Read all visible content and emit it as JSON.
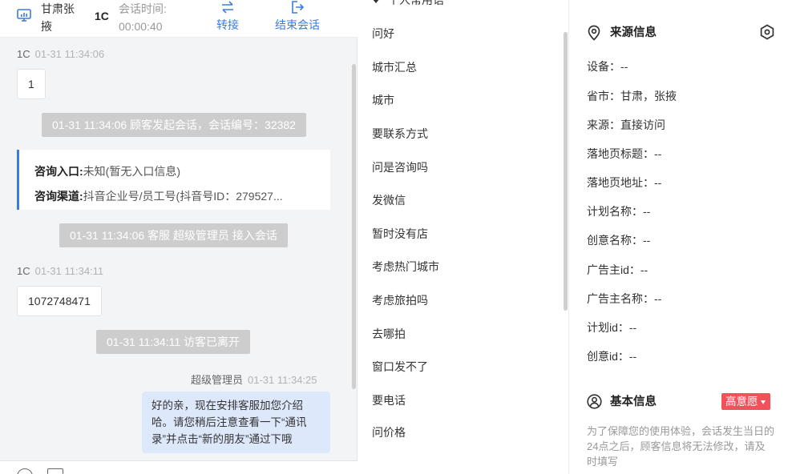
{
  "header": {
    "visitor_name": "甘肃张掖",
    "visitor_id": "1C",
    "session_time_label": "会话时间:",
    "session_time_value": "00:00:40",
    "transfer_label": "转接",
    "end_label": "结束会话"
  },
  "messages": [
    {
      "sender": "1C",
      "time": "01-31 11:34:06",
      "text": "1"
    },
    {
      "system": "01-31 11:34:06 顾客发起会话，会话编号：32382"
    },
    {
      "card": {
        "entry_key": "咨询入口:",
        "entry_value": "未知(暂无入口信息)",
        "channel_key": "咨询渠道:",
        "channel_value": "抖音企业号/员工号(抖音号ID：279527..."
      }
    },
    {
      "system": "01-31 11:34:06 客服 超级管理员 接入会话"
    },
    {
      "sender": "1C",
      "time": "01-31 11:34:11",
      "text": "1072748471"
    },
    {
      "system": "01-31 11:34:11 访客已离开"
    },
    {
      "sender": "超级管理员",
      "time": "01-31 11:34:25",
      "text": "好的亲，现在安排客服加您介绍哈。请您稍后注意查看一下“通讯录”并点击“新的朋友”通过下哦"
    }
  ],
  "phrases": {
    "group_label": "个人常用语",
    "items": [
      "问好",
      "城市汇总",
      "城市",
      "要联系方式",
      "问是咨询吗",
      "发微信",
      "暂时没有店",
      "考虑热门城市",
      "考虑旅拍吗",
      "去哪拍",
      "窗口发不了",
      "要电话",
      "问价格"
    ]
  },
  "source_info": {
    "title": "来源信息",
    "fields": [
      "设备：--",
      "省市：甘肃，张掖",
      "来源：直接访问",
      "落地页标题：--",
      "落地页地址：--",
      "计划名称：--",
      "创意名称：--",
      "广告主id：--",
      "广告主名称：--",
      "计划id：--",
      "创意id：--"
    ]
  },
  "basic_info": {
    "title": "基本信息",
    "intent_tag": "高意愿",
    "note": "为了保障您的使用体验，会话发生当日的24点之后，顾客信息将无法修改，请及时填写"
  },
  "colors": {
    "accent": "#3b7ddd",
    "tag": "#f1525a",
    "agent_bubble": "#dde9fb",
    "system_notice": "#cdcdcd"
  }
}
